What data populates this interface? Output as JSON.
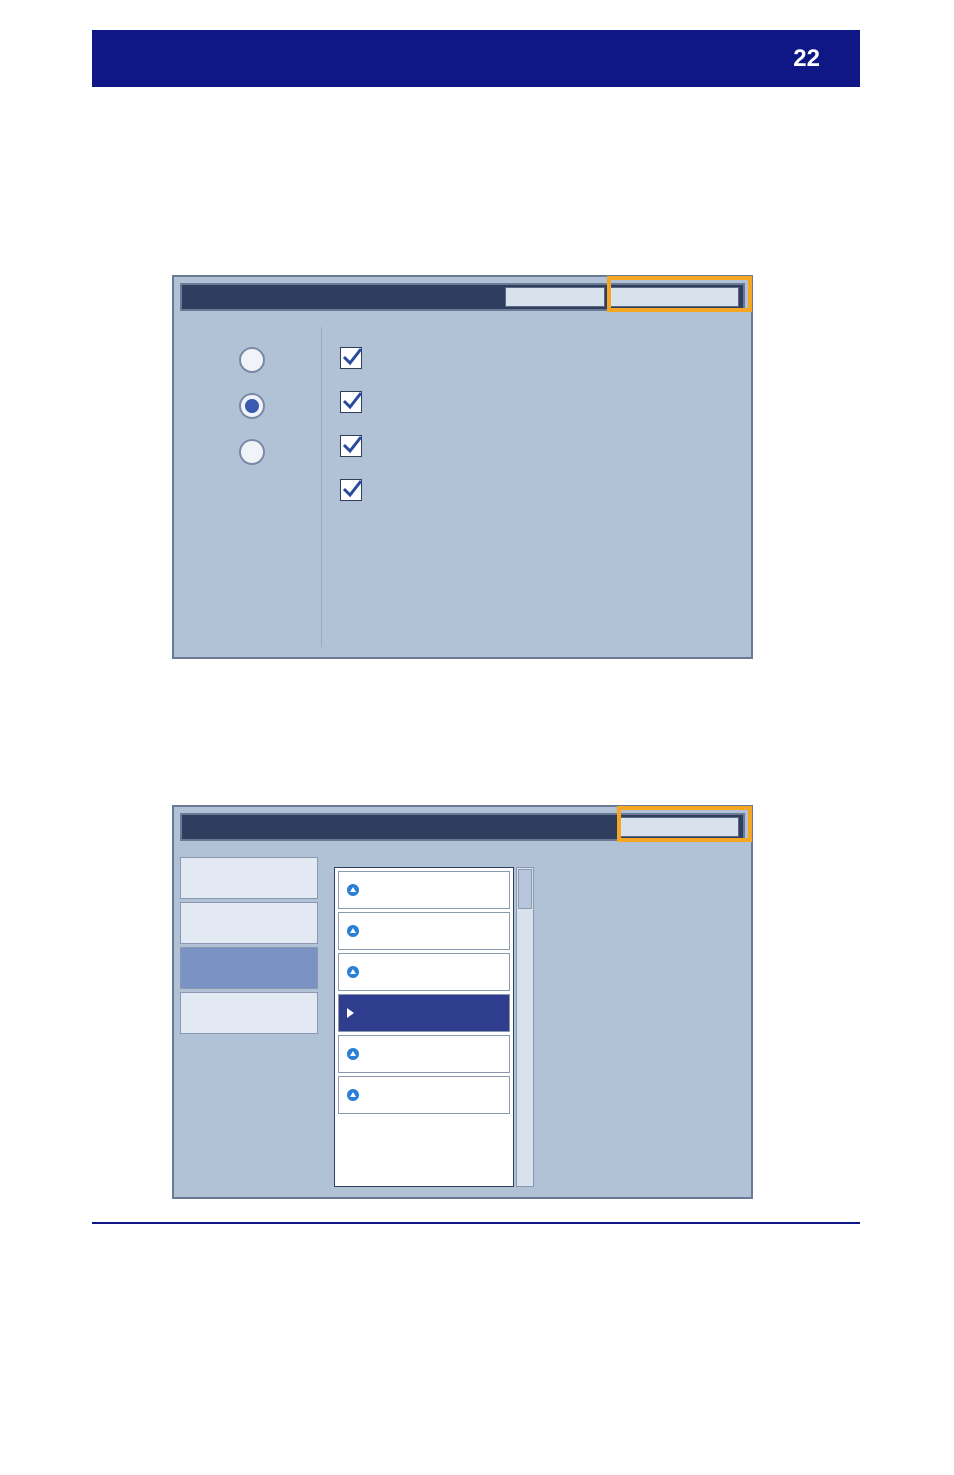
{
  "header": {
    "page_number": "22"
  },
  "panel1": {
    "radios": [
      {
        "selected": false
      },
      {
        "selected": true
      },
      {
        "selected": false
      }
    ],
    "checkboxes": [
      {
        "checked": true
      },
      {
        "checked": true
      },
      {
        "checked": true
      },
      {
        "checked": true
      }
    ]
  },
  "panel2": {
    "sidebar_items": [
      {
        "active": false
      },
      {
        "active": false
      },
      {
        "active": true
      },
      {
        "active": false
      }
    ],
    "list_items": [
      {
        "type": "dot"
      },
      {
        "type": "dot"
      },
      {
        "type": "dot"
      },
      {
        "type": "play",
        "selected": true
      },
      {
        "type": "dot"
      },
      {
        "type": "dot"
      }
    ]
  }
}
